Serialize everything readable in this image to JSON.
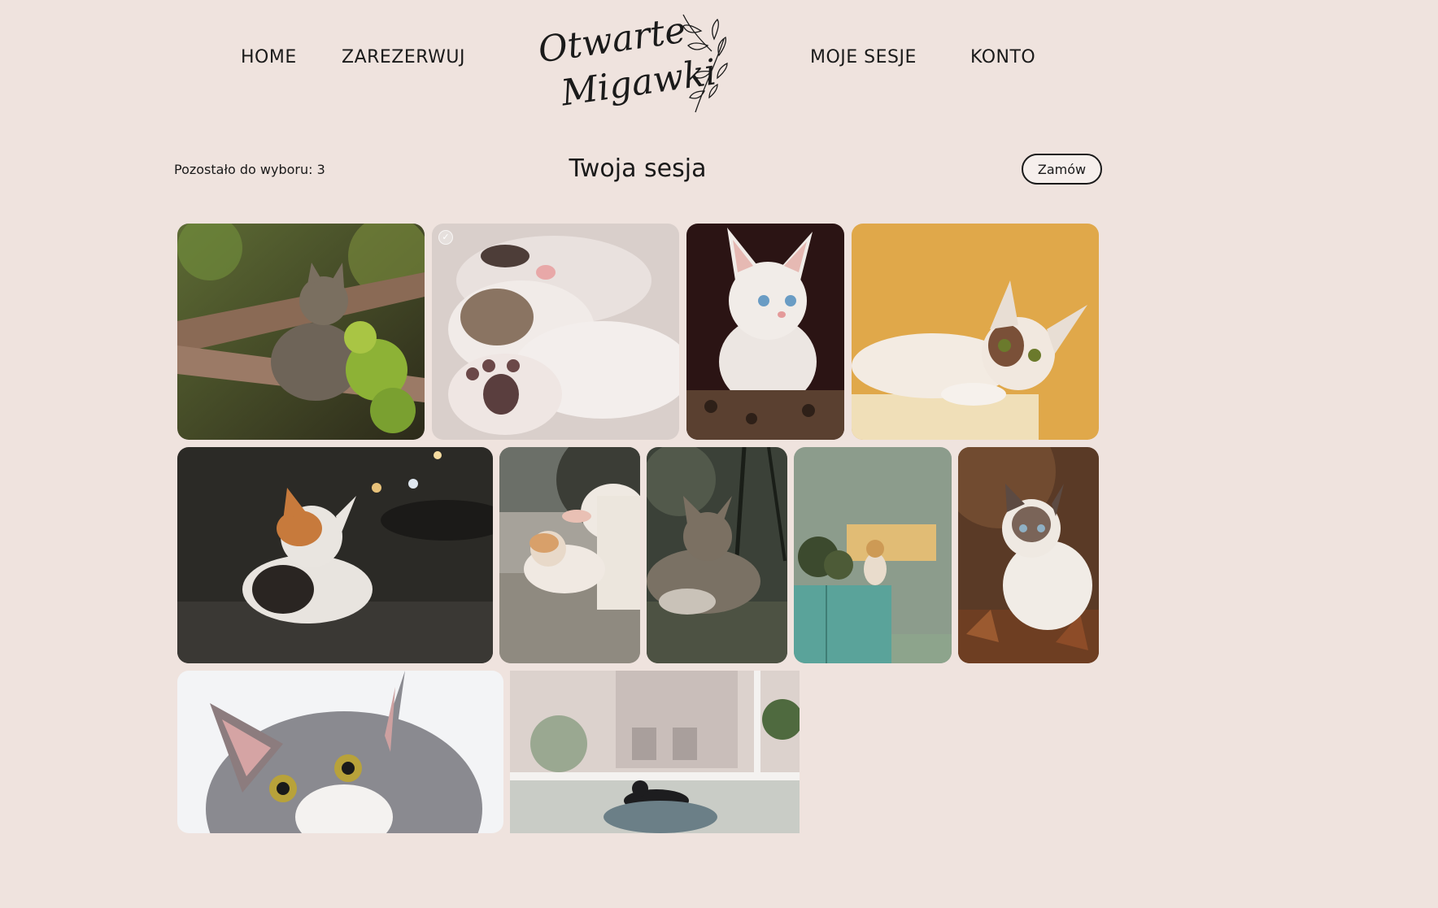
{
  "nav": {
    "home": "HOME",
    "book": "ZAREZERWUJ",
    "sessions": "MOJE SESJE",
    "account": "KONTO"
  },
  "logo": {
    "line1": "Otwarte",
    "line2": "Migawki"
  },
  "session": {
    "remaining_label": "Pozostało do wyboru: 3",
    "title": "Twoja sesja",
    "order_button": "Zamów"
  },
  "photos": [
    {
      "subject": "tabby cat on railing with vine leaves",
      "selected": false
    },
    {
      "subject": "sleeping kittens paws close-up",
      "selected": true
    },
    {
      "subject": "white kitten with blue eyes",
      "selected": false
    },
    {
      "subject": "calico kitten on yellow background",
      "selected": false
    },
    {
      "subject": "calico cat on dark sofa",
      "selected": false
    },
    {
      "subject": "hand petting ginger white cat",
      "selected": false
    },
    {
      "subject": "tabby cat lying in grass",
      "selected": false
    },
    {
      "subject": "cat on teal cabinet with plants",
      "selected": false
    },
    {
      "subject": "siamese kitten in autumn leaves",
      "selected": false
    },
    {
      "subject": "grey white cat face close-up",
      "selected": false
    },
    {
      "subject": "black cat on bed by window",
      "selected": false
    }
  ],
  "colors": {
    "background": "#efe3de",
    "text": "#1a1a1a"
  }
}
